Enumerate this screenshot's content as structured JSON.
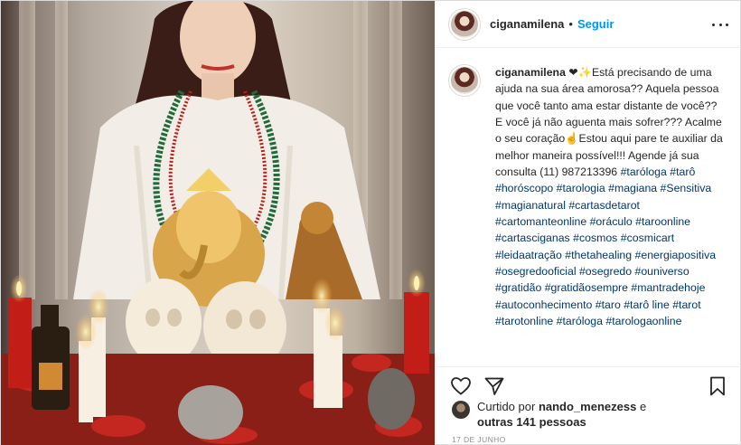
{
  "post": {
    "username": "ciganamilena",
    "follow_label": "Seguir",
    "separator": "•",
    "caption": {
      "username": "ciganamilena",
      "text": "❤✨️Está precisando de uma ajuda na sua área amorosa?? Aquela pessoa que você tanto ama estar distante de você?? E você já não aguenta mais sofrer??? Acalme o seu coração☝️Estou aqui pare te auxiliar da melhor maneira possível!!! Agende já sua consulta (11) 987213396",
      "hashtags": "#taróloga #tarô #horóscopo #tarologia #magiana #Sensitiva #magianatural #cartasdetarot #cartomanteonline #oráculo #taroonline #cartasciganas #cosmos #cosmicart #leidaatração #thetahealing #energiaposit​iva #osegredooficial #osegredo #ounivers​o #gratidão #gratidãosempre #mantradehoje #autoconhecimento #taro​ #tarô line #tarot #tarotonline #taróloga #tarologaonline"
    },
    "likes": {
      "prefix": "Curtido por",
      "user": "nando_menezess",
      "connector": "e",
      "others": "outras 141 pessoas"
    },
    "date": "17 DE JUNHO"
  },
  "icons": {
    "more": "more-options-icon",
    "like": "heart-icon",
    "share": "paper-plane-icon",
    "save": "bookmark-icon"
  },
  "colors": {
    "link_blue": "#0095f6",
    "hashtag": "#00376b",
    "muted": "#8e8e8e",
    "border": "#dbdbdb"
  }
}
